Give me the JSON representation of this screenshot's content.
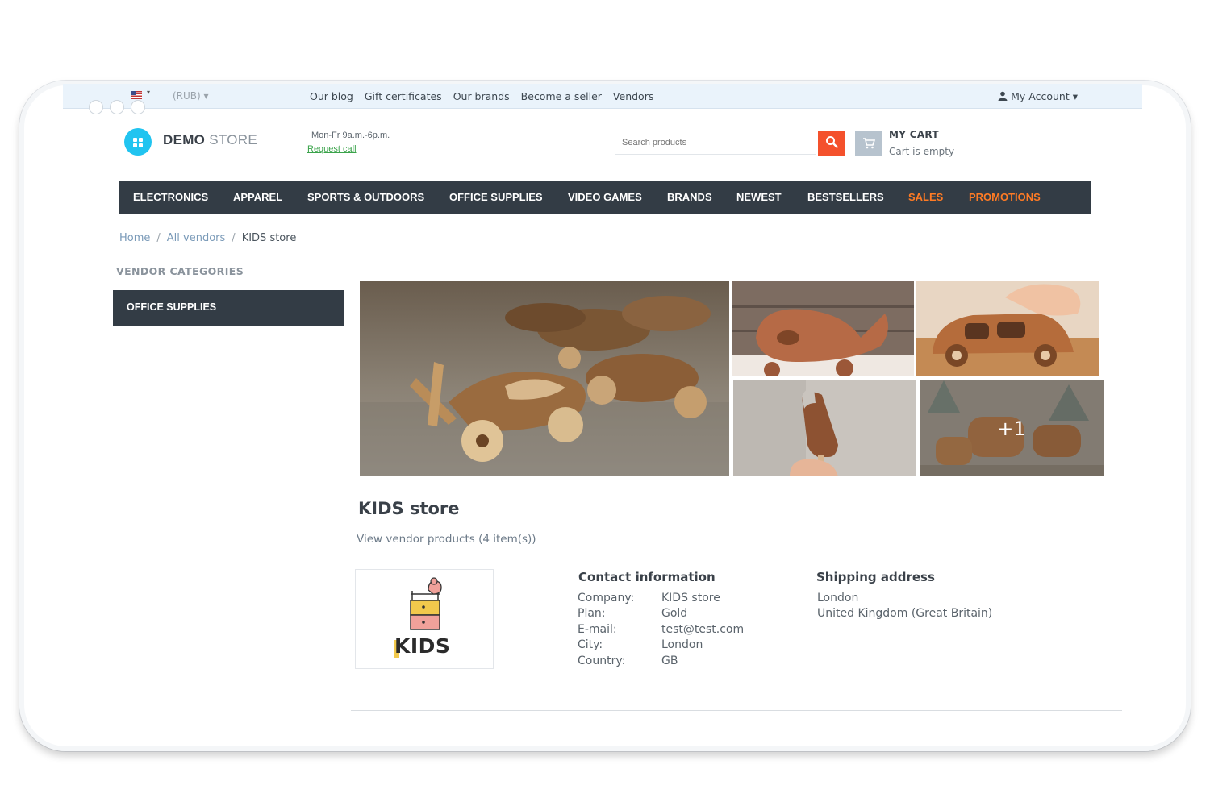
{
  "topbar": {
    "currency": "(RUB)",
    "links": [
      "Our blog",
      "Gift certificates",
      "Our brands",
      "Become a seller",
      "Vendors"
    ],
    "account": "My Account"
  },
  "header": {
    "logo_bold": "DEMO",
    "logo_light": "STORE",
    "hours": "Mon-Fr 9a.m.-6p.m.",
    "request_call": "Request call",
    "search_placeholder": "Search products",
    "cart_title": "MY CART",
    "cart_status": "Cart is empty"
  },
  "nav": [
    "ELECTRONICS",
    "APPAREL",
    "SPORTS & OUTDOORS",
    "OFFICE SUPPLIES",
    "VIDEO GAMES",
    "BRANDS",
    "NEWEST",
    "BESTSELLERS",
    "SALES",
    "PROMOTIONS"
  ],
  "breadcrumb": {
    "home": "Home",
    "vendors": "All vendors",
    "current": "KIDS store",
    "separator": "/"
  },
  "sidebar": {
    "title": "VENDOR CATEGORIES",
    "items": [
      "OFFICE SUPPLIES"
    ]
  },
  "gallery": {
    "more_label": "+1"
  },
  "vendor": {
    "name": "KIDS store",
    "products_link": "View vendor products (4 item(s))",
    "logo_text": "KIDS"
  },
  "contact": {
    "title": "Contact information",
    "rows": [
      {
        "label": "Company:",
        "value": "KIDS store"
      },
      {
        "label": "Plan:",
        "value": "Gold"
      },
      {
        "label": "E-mail:",
        "value": "test@test.com"
      },
      {
        "label": "City:",
        "value": "London"
      },
      {
        "label": "Country:",
        "value": "GB"
      }
    ]
  },
  "shipping": {
    "title": "Shipping address",
    "lines": [
      "London",
      "United Kingdom (Great Britain)"
    ]
  },
  "colors": {
    "accent": "#f4512c",
    "nav_bg": "#333c45",
    "promo": "#ff7b24",
    "logo": "#21c4f0"
  }
}
